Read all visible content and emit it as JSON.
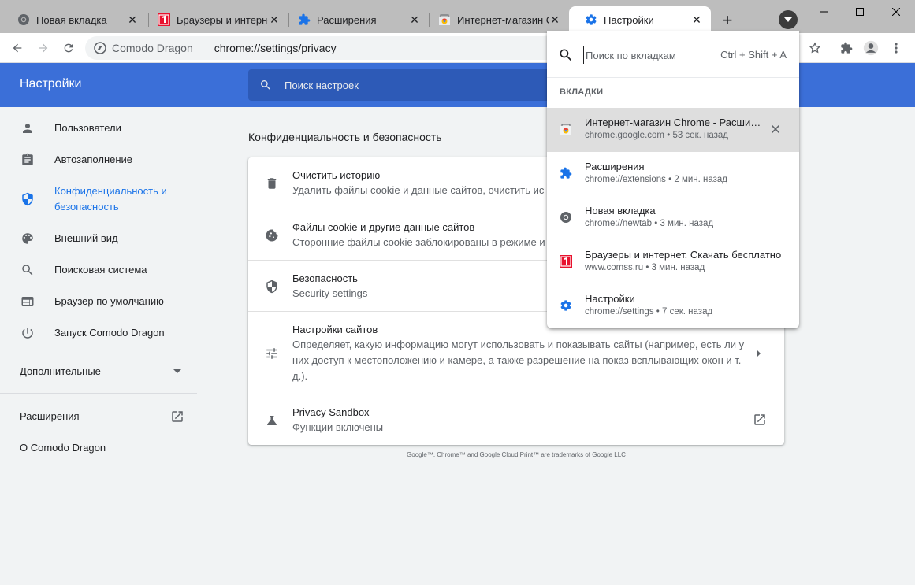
{
  "colors": {
    "accent": "#3b6fd8",
    "search_bg": "#2d5ab7",
    "active_link": "#1a73e8",
    "tabstrip": "#bdbdbd"
  },
  "tabs": [
    {
      "title": "Новая вкладка",
      "icon": "chrome-icon"
    },
    {
      "title": "Браузеры и интерне",
      "icon": "comss-icon"
    },
    {
      "title": "Расширения",
      "icon": "puzzle-icon"
    },
    {
      "title": "Интернет-магазин С",
      "icon": "webstore-icon"
    },
    {
      "title": "Настройки",
      "icon": "gear-icon",
      "active": true
    }
  ],
  "toolbar": {
    "site_name": "Comodo Dragon",
    "url": "chrome://settings/privacy"
  },
  "settings": {
    "title": "Настройки",
    "search_placeholder": "Поиск настроек"
  },
  "sidebar": {
    "items": [
      {
        "label": "Пользователи",
        "icon": "person-icon"
      },
      {
        "label": "Автозаполнение",
        "icon": "clipboard-icon"
      },
      {
        "label": "Конфиденциальность и безопасность",
        "icon": "shield-icon",
        "active": true
      },
      {
        "label": "Внешний вид",
        "icon": "palette-icon"
      },
      {
        "label": "Поисковая система",
        "icon": "search-icon"
      },
      {
        "label": "Браузер по умолчанию",
        "icon": "browser-window-icon"
      },
      {
        "label": "Запуск Comodo Dragon",
        "icon": "power-icon"
      }
    ],
    "advanced": "Дополнительные",
    "extensions": "Расширения",
    "about": "О Comodo Dragon"
  },
  "main": {
    "section_title": "Конфиденциальность и безопасность",
    "rows": [
      {
        "title": "Очистить историю",
        "subtitle": "Удалить файлы cookie и данные сайтов, очистить ис",
        "icon": "trash-icon"
      },
      {
        "title": "Файлы cookie и другие данные сайтов",
        "subtitle": "Сторонние файлы cookie заблокированы в режиме и",
        "icon": "cookie-icon"
      },
      {
        "title": "Безопасность",
        "subtitle": "Security settings",
        "icon": "shield-icon"
      },
      {
        "title": "Настройки сайтов",
        "subtitle": "Определяет, какую информацию могут использовать и показывать сайты (например, есть ли у них доступ к местоположению и камере, а также разрешение на показ всплывающих окон и т. д.).",
        "icon": "tune-icon"
      },
      {
        "title": "Privacy Sandbox",
        "subtitle": "Функции включены",
        "icon": "flask-icon"
      }
    ],
    "footer": "Google™, Chrome™ and Google Cloud Print™ are trademarks of Google LLC"
  },
  "tab_search": {
    "placeholder": "Поиск по вкладкам",
    "shortcut": "Ctrl + Shift + A",
    "section": "ВКЛАДКИ",
    "items": [
      {
        "title": "Интернет-магазин Chrome - Расширения",
        "domain": "chrome.google.com",
        "time": "53 сек. назад",
        "icon": "webstore-icon",
        "selected": true
      },
      {
        "title": "Расширения",
        "domain": "chrome://extensions",
        "time": "2 мин. назад",
        "icon": "puzzle-icon"
      },
      {
        "title": "Новая вкладка",
        "domain": "chrome://newtab",
        "time": "3 мин. назад",
        "icon": "chrome-icon"
      },
      {
        "title": "Браузеры и интернет. Скачать бесплатно",
        "domain": "www.comss.ru",
        "time": "3 мин. назад",
        "icon": "comss-icon"
      },
      {
        "title": "Настройки",
        "domain": "chrome://settings",
        "time": "7 сек. назад",
        "icon": "gear-icon"
      }
    ],
    "separator": "•"
  }
}
